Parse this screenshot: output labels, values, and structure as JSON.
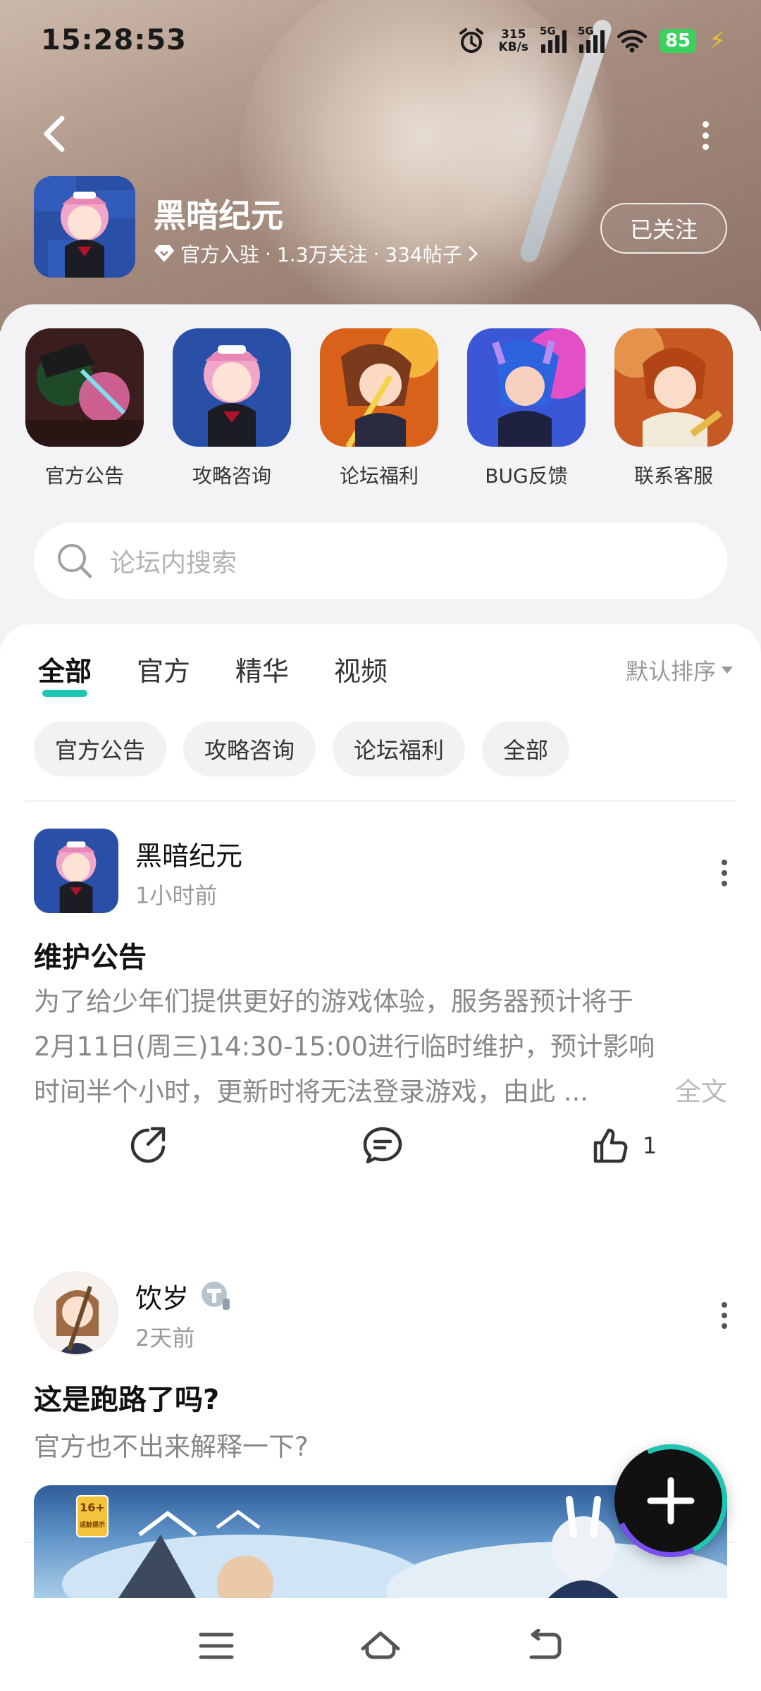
{
  "status_bar": {
    "time": "15:28:53",
    "net_speed": "315",
    "net_speed_unit": "KB/s",
    "sim1": "5G",
    "sim2": "5G",
    "battery": "85",
    "icons": [
      "alarm-icon",
      "signal-icon",
      "wifi-icon",
      "battery-icon",
      "charging-icon"
    ]
  },
  "header": {
    "game_title": "黑暗纪元",
    "verified_label": "官方入驻",
    "followers": "1.3万关注",
    "posts": "334帖子",
    "separator": "·",
    "follow_button": "已关注"
  },
  "quick_links": [
    {
      "label": "官方公告"
    },
    {
      "label": "攻略咨询"
    },
    {
      "label": "论坛福利"
    },
    {
      "label": "BUG反馈"
    },
    {
      "label": "联系客服"
    }
  ],
  "search": {
    "placeholder": "论坛内搜索"
  },
  "tabs": [
    {
      "label": "全部",
      "active": true
    },
    {
      "label": "官方"
    },
    {
      "label": "精华"
    },
    {
      "label": "视频"
    }
  ],
  "sort_label": "默认排序",
  "chips": [
    "官方公告",
    "攻略咨询",
    "论坛福利",
    "全部"
  ],
  "posts": [
    {
      "author": "黑暗纪元",
      "time": "1小时前",
      "title": "维护公告",
      "body_lines": [
        "为了给少年们提供更好的游戏体验，服务器预计将于",
        "2月11日(周三)14:30-15:00进行临时维护，预计影响",
        "时间半个小时，更新时将无法登录游戏，由此 ..."
      ],
      "full_text": "全文",
      "likes": "1"
    },
    {
      "author": "饮岁",
      "time": "2天前",
      "title": "这是跑路了吗?",
      "body": "官方也不出来解释一下?",
      "age_rating": "16+",
      "age_note": "适龄提示"
    }
  ],
  "colors": {
    "accent": "#21c6b3",
    "battery": "#3bd15e"
  }
}
